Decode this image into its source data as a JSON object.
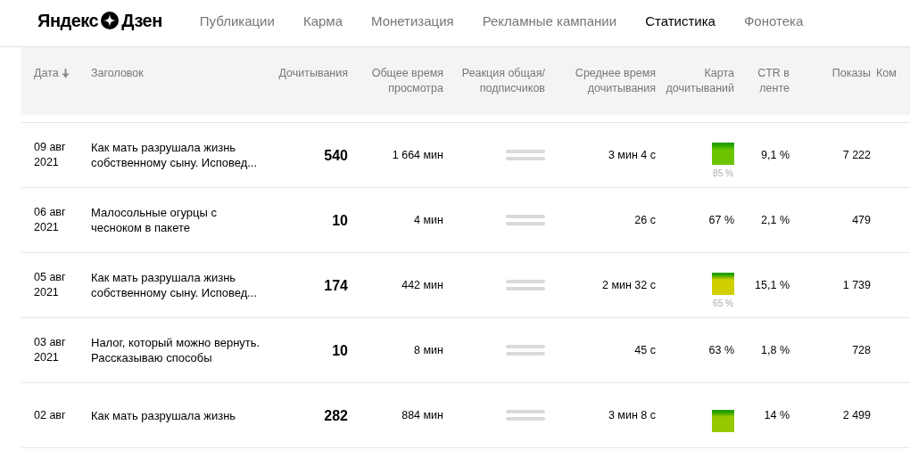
{
  "logo": {
    "left": "Яндекс",
    "right": "Дзен"
  },
  "nav": [
    {
      "label": "Публикации",
      "selected": false
    },
    {
      "label": "Карма",
      "selected": false
    },
    {
      "label": "Монетизация",
      "selected": false
    },
    {
      "label": "Рекламные кампании",
      "selected": false
    },
    {
      "label": "Статистика",
      "selected": true
    },
    {
      "label": "Фонотека",
      "selected": false
    }
  ],
  "table": {
    "columns": [
      "Дата",
      "Заголовок",
      "Дочитывания",
      "Общее время просмотра",
      "Реакция общая/ подписчиков",
      "Среднее время дочитывания",
      "Карта дочитываний",
      "CTR в ленте",
      "Показы",
      "Ком"
    ],
    "rows": [
      {
        "date": "09 авг 2021",
        "title": "Как мать разрушала жизнь собственному сыну. Исповед...",
        "reads": "540",
        "total_time": "1 664 мин",
        "avg_time": "3 мин 4 с",
        "map": {
          "kind": "bar",
          "color": "#6cc400",
          "value": "85 %"
        },
        "ctr": "9,1 %",
        "shows": "7 222"
      },
      {
        "date": "06 авг 2021",
        "title": "Малосольные огурцы с чесноком в пакете",
        "reads": "10",
        "total_time": "4 мин",
        "avg_time": "26 с",
        "map": {
          "kind": "text",
          "value": "67 %"
        },
        "ctr": "2,1 %",
        "shows": "479"
      },
      {
        "date": "05 авг 2021",
        "title": "Как мать разрушала жизнь собственному сыну. Исповед...",
        "reads": "174",
        "total_time": "442 мин",
        "avg_time": "2 мин 32 с",
        "map": {
          "kind": "bar",
          "color": "#d0d000",
          "value": "65 %"
        },
        "ctr": "15,1 %",
        "shows": "1 739"
      },
      {
        "date": "03 авг 2021",
        "title": "Налог, который можно вернуть. Рассказываю способы",
        "reads": "10",
        "total_time": "8 мин",
        "avg_time": "45 с",
        "map": {
          "kind": "text",
          "value": "63 %"
        },
        "ctr": "1,8 %",
        "shows": "728"
      },
      {
        "date": "02 авг",
        "title": "Как мать разрушала жизнь",
        "reads": "282",
        "total_time": "884 мин",
        "avg_time": "3 мин 8 с",
        "map": {
          "kind": "bar",
          "color": "#98c800"
        },
        "ctr": "14 %",
        "shows": "2 499"
      }
    ]
  }
}
